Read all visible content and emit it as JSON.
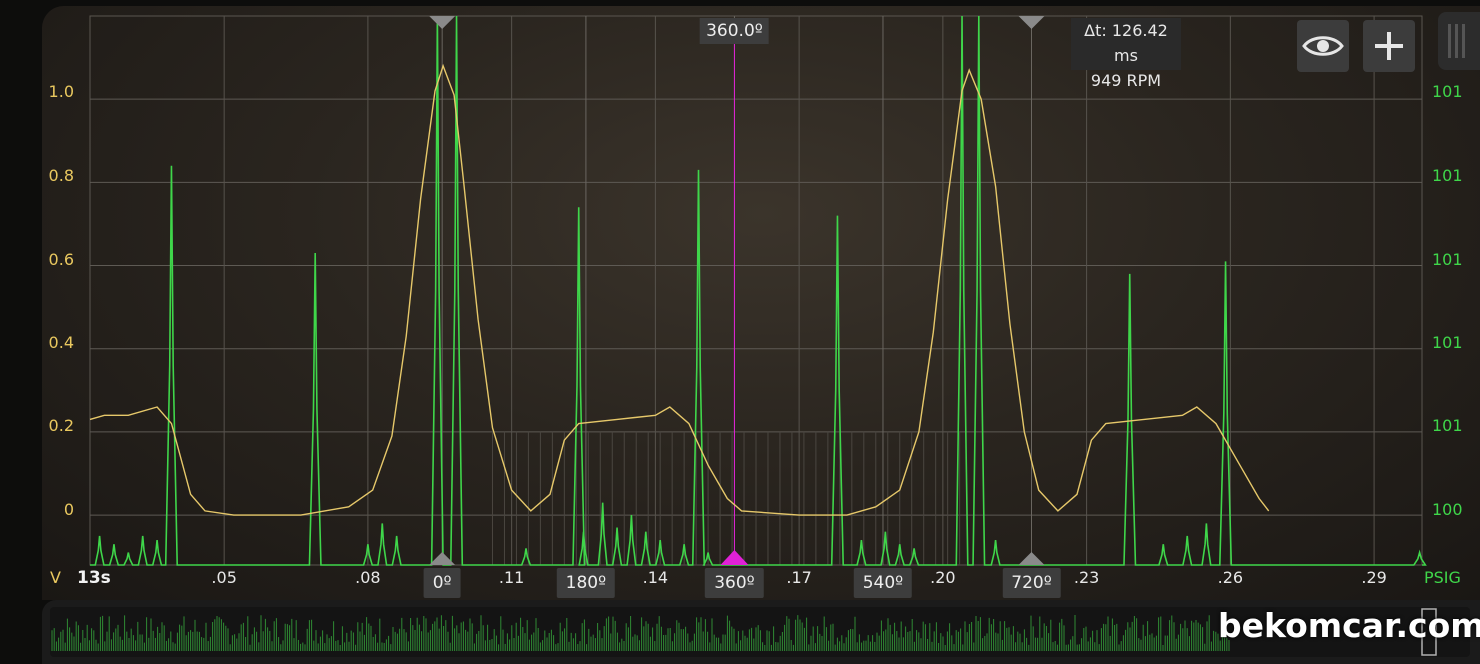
{
  "chart_data": {
    "type": "line",
    "x_axis": {
      "first_label": "13s",
      "tick_labels": [
        ".05",
        ".08",
        ".11",
        ".14",
        ".17",
        ".20",
        ".23",
        ".26",
        ".29"
      ],
      "tick_values": [
        0.05,
        0.08,
        0.11,
        0.14,
        0.17,
        0.2,
        0.23,
        0.26,
        0.29
      ],
      "range": [
        0.022,
        0.3
      ]
    },
    "y_left": {
      "unit": "V",
      "tick_labels": [
        "1.0",
        "0.8",
        "0.6",
        "0.4",
        "0.2",
        "0"
      ],
      "tick_values": [
        1.0,
        0.8,
        0.6,
        0.4,
        0.2,
        0.0
      ],
      "range": [
        -0.12,
        1.2
      ]
    },
    "y_right": {
      "unit": "PSIG",
      "tick_labels": [
        "101",
        "101",
        "101",
        "101",
        "101",
        "100"
      ]
    },
    "series": [
      {
        "color": "#e6c86a",
        "axis": "left",
        "points": [
          [
            0.022,
            0.23
          ],
          [
            0.025,
            0.24
          ],
          [
            0.03,
            0.24
          ],
          [
            0.036,
            0.26
          ],
          [
            0.039,
            0.22
          ],
          [
            0.043,
            0.05
          ],
          [
            0.046,
            0.01
          ],
          [
            0.052,
            0.0
          ],
          [
            0.066,
            0.0
          ],
          [
            0.076,
            0.02
          ],
          [
            0.081,
            0.06
          ],
          [
            0.085,
            0.19
          ],
          [
            0.088,
            0.43
          ],
          [
            0.091,
            0.76
          ],
          [
            0.094,
            1.02
          ],
          [
            0.0957,
            1.08
          ],
          [
            0.098,
            1.01
          ],
          [
            0.1,
            0.8
          ],
          [
            0.103,
            0.47
          ],
          [
            0.106,
            0.21
          ],
          [
            0.11,
            0.06
          ],
          [
            0.114,
            0.01
          ],
          [
            0.118,
            0.05
          ],
          [
            0.121,
            0.18
          ],
          [
            0.124,
            0.22
          ],
          [
            0.132,
            0.23
          ],
          [
            0.14,
            0.24
          ],
          [
            0.143,
            0.26
          ],
          [
            0.147,
            0.22
          ],
          [
            0.151,
            0.12
          ],
          [
            0.155,
            0.04
          ],
          [
            0.158,
            0.01
          ],
          [
            0.17,
            0.0
          ],
          [
            0.18,
            0.0
          ],
          [
            0.186,
            0.02
          ],
          [
            0.191,
            0.06
          ],
          [
            0.195,
            0.2
          ],
          [
            0.198,
            0.44
          ],
          [
            0.201,
            0.76
          ],
          [
            0.204,
            1.02
          ],
          [
            0.2055,
            1.07
          ],
          [
            0.208,
            1.0
          ],
          [
            0.211,
            0.79
          ],
          [
            0.214,
            0.46
          ],
          [
            0.217,
            0.2
          ],
          [
            0.22,
            0.06
          ],
          [
            0.224,
            0.01
          ],
          [
            0.228,
            0.05
          ],
          [
            0.231,
            0.18
          ],
          [
            0.234,
            0.22
          ],
          [
            0.242,
            0.23
          ],
          [
            0.25,
            0.24
          ],
          [
            0.253,
            0.26
          ],
          [
            0.257,
            0.22
          ],
          [
            0.262,
            0.12
          ],
          [
            0.266,
            0.04
          ],
          [
            0.268,
            0.01
          ]
        ]
      },
      {
        "color": "#3fd64a",
        "axis": "left",
        "spikes": [
          [
            0.039,
            0.84
          ],
          [
            0.069,
            0.63
          ],
          [
            0.0945,
            1.2
          ],
          [
            0.0985,
            1.2
          ],
          [
            0.124,
            0.74
          ],
          [
            0.149,
            0.83
          ],
          [
            0.178,
            0.72
          ],
          [
            0.204,
            1.2
          ],
          [
            0.2075,
            1.2
          ],
          [
            0.239,
            0.58
          ],
          [
            0.259,
            0.61
          ],
          [
            0.2995,
            -0.09
          ]
        ],
        "noise": [
          [
            0.024,
            -0.05
          ],
          [
            0.027,
            -0.07
          ],
          [
            0.03,
            -0.09
          ],
          [
            0.033,
            -0.05
          ],
          [
            0.036,
            -0.06
          ],
          [
            0.08,
            -0.07
          ],
          [
            0.083,
            -0.02
          ],
          [
            0.086,
            -0.05
          ],
          [
            0.113,
            -0.08
          ],
          [
            0.125,
            -0.04
          ],
          [
            0.129,
            0.03
          ],
          [
            0.132,
            -0.03
          ],
          [
            0.135,
            0.0
          ],
          [
            0.138,
            -0.04
          ],
          [
            0.141,
            -0.06
          ],
          [
            0.146,
            -0.07
          ],
          [
            0.151,
            -0.09
          ],
          [
            0.183,
            -0.06
          ],
          [
            0.188,
            -0.04
          ],
          [
            0.191,
            -0.07
          ],
          [
            0.194,
            -0.08
          ],
          [
            0.211,
            -0.06
          ],
          [
            0.246,
            -0.07
          ],
          [
            0.251,
            -0.05
          ],
          [
            0.255,
            -0.02
          ]
        ]
      }
    ],
    "markers": [
      {
        "label": "0º",
        "x": 0.0955
      },
      {
        "label": "180º",
        "x": 0.1255
      },
      {
        "label": "360º",
        "x": 0.1565
      },
      {
        "label": "540º",
        "x": 0.1875
      },
      {
        "label": "720º",
        "x": 0.2185
      }
    ],
    "cursor": {
      "x": 0.1565,
      "label": "360.0º"
    },
    "delta": {
      "time": "Δt: 126.42 ms",
      "rpm": "949 RPM"
    },
    "grid": true
  },
  "toolbar": {
    "eye_icon": "eye-icon",
    "add_icon": "plus-icon"
  },
  "watermark": "bekomcar.com",
  "colors": {
    "yellow": "#e9c85f",
    "green": "#3fd64a",
    "magenta": "#e021d6"
  }
}
